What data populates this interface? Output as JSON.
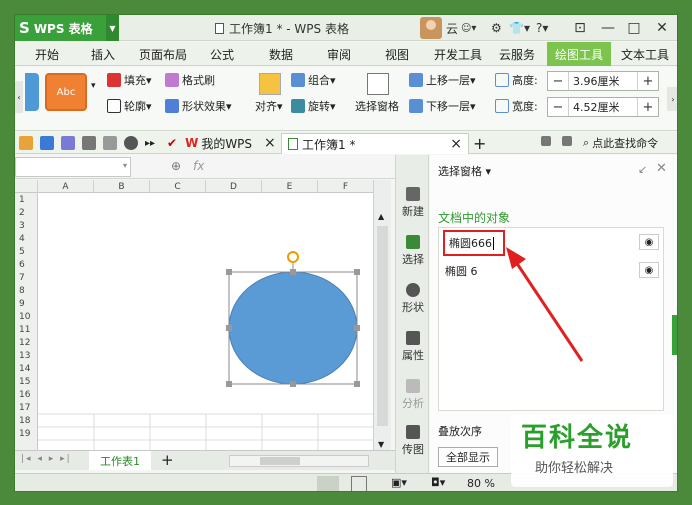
{
  "titlebar": {
    "app_name": "WPS 表格",
    "app_logo": "S",
    "document_title": "工作簿1 * - WPS 表格",
    "user_name": "云",
    "help": "?",
    "controls": {
      "minimize": "—",
      "maximize": "□",
      "close": "✕"
    }
  },
  "menu": {
    "tabs": [
      "开始",
      "插入",
      "页面布局",
      "公式",
      "数据",
      "审阅",
      "视图",
      "开发工具",
      "云服务",
      "绘图工具",
      "文本工具"
    ],
    "active_tab": "绘图工具"
  },
  "ribbon": {
    "style_preview": "Abc",
    "fill": "填充",
    "format_brush": "格式刷",
    "outline": "轮廓",
    "shape_effect": "形状效果",
    "align": "对齐",
    "group": "组合",
    "rotate": "旋转",
    "selection_pane": "选择窗格",
    "bring_forward": "上移一层",
    "send_backward": "下移一层",
    "height_label": "高度:",
    "height_value": "3.96厘米",
    "width_label": "宽度:",
    "width_value": "4.52厘米",
    "minus": "−",
    "plus": "+"
  },
  "quickbar": {
    "my_wps": "我的WPS",
    "doc_tab": "工作簿1 *",
    "close_tab": "×",
    "new_tab": "+",
    "search": "点此查找命令"
  },
  "formula_bar": {
    "fx": "fx"
  },
  "sheet": {
    "columns": [
      "A",
      "B",
      "C",
      "D",
      "E",
      "F"
    ],
    "rows": [
      "1",
      "2",
      "3",
      "4",
      "5",
      "6",
      "7",
      "8",
      "9",
      "10",
      "11",
      "12",
      "13",
      "14",
      "15",
      "16",
      "17",
      "18",
      "19"
    ],
    "sheet_tab": "工作表1",
    "add_sheet": "+",
    "shape_fill": "#5b9bd5"
  },
  "side_strip": {
    "items": [
      "新建",
      "选择",
      "形状",
      "属性",
      "分析",
      "传图"
    ]
  },
  "selection_pane": {
    "title": "选择窗格",
    "section_title": "文档中的对象",
    "objects": [
      "椭圆666",
      "椭圆 6"
    ],
    "stacking_label": "叠放次序",
    "show_all": "全部显示"
  },
  "statusbar": {
    "zoom": "80 %"
  },
  "watermark": {
    "title": "百科全说",
    "subtitle": "助你轻松解决"
  },
  "colors": {
    "accent_green": "#3aa13a",
    "active_tab": "#7cc44e",
    "highlight_red": "#e02020"
  }
}
